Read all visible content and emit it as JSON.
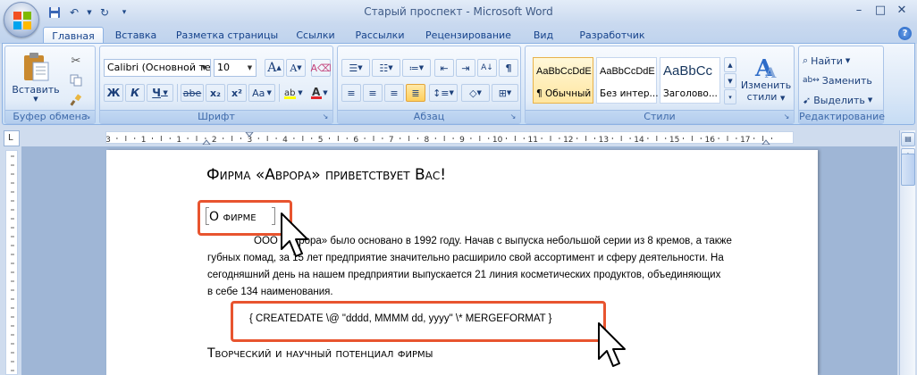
{
  "window": {
    "title": "Старый проспект - Microsoft Word"
  },
  "tabs": [
    {
      "label": "Главная",
      "active": true
    },
    {
      "label": "Вставка"
    },
    {
      "label": "Разметка страницы"
    },
    {
      "label": "Ссылки"
    },
    {
      "label": "Рассылки"
    },
    {
      "label": "Рецензирование"
    },
    {
      "label": "Вид"
    },
    {
      "label": "Разработчик"
    }
  ],
  "ribbon": {
    "clipboard": {
      "label": "Буфер обмена",
      "paste_label": "Вставить"
    },
    "font": {
      "label": "Шрифт",
      "font_name": "Calibri (Основной те",
      "font_size": "10",
      "bold": "Ж",
      "italic": "К",
      "underline": "Ч",
      "strike": "abe",
      "subscript": "x₂",
      "superscript": "x²",
      "change_case": "Aa",
      "grow": "A",
      "shrink": "A"
    },
    "paragraph": {
      "label": "Абзац"
    },
    "styles": {
      "label": "Стили",
      "tiles": [
        {
          "sample": "AaBbCcDdE",
          "name": "¶ Обычный",
          "selected": true
        },
        {
          "sample": "AaBbCcDdE",
          "name": "Без интер..."
        },
        {
          "sample": "AaBbCc",
          "name": "Заголово..."
        }
      ],
      "change_styles_line1": "Изменить",
      "change_styles_line2": "стили"
    },
    "editing": {
      "label": "Редактирование",
      "find": "Найти",
      "replace": "Заменить",
      "select": "Выделить"
    }
  },
  "ruler": {
    "labels": [
      "3",
      "1",
      "1",
      "2",
      "3",
      "4",
      "5",
      "6",
      "7",
      "8",
      "9",
      "10",
      "11",
      "12",
      "13",
      "14",
      "15",
      "16",
      "17"
    ]
  },
  "document": {
    "heading1": "Фирма «Аврора» приветствует Вас!",
    "heading2": "О фирме",
    "paragraph_lines": [
      "ООО «Аврора» было основано в 1992 году. Начав с выпуска небольшой серии из 8 кремов, а также",
      "губных помад, за 15 лет предприятие значительно расширило свой ассортимент и сферу деятельности. На",
      "сегодняшний день на нашем предприятии выпускается 21 линия косметических продуктов, объединяющих",
      "в себе 134 наименования."
    ],
    "field_code": "{ CREATEDATE  \\@ \"dddd, MMMM dd, yyyy\"  \\* MERGEFORMAT }",
    "heading3": "Творческий и научный потенциал фирмы"
  },
  "colors": {
    "highlight": "#e8542f",
    "ribbon_text": "#15428b"
  }
}
